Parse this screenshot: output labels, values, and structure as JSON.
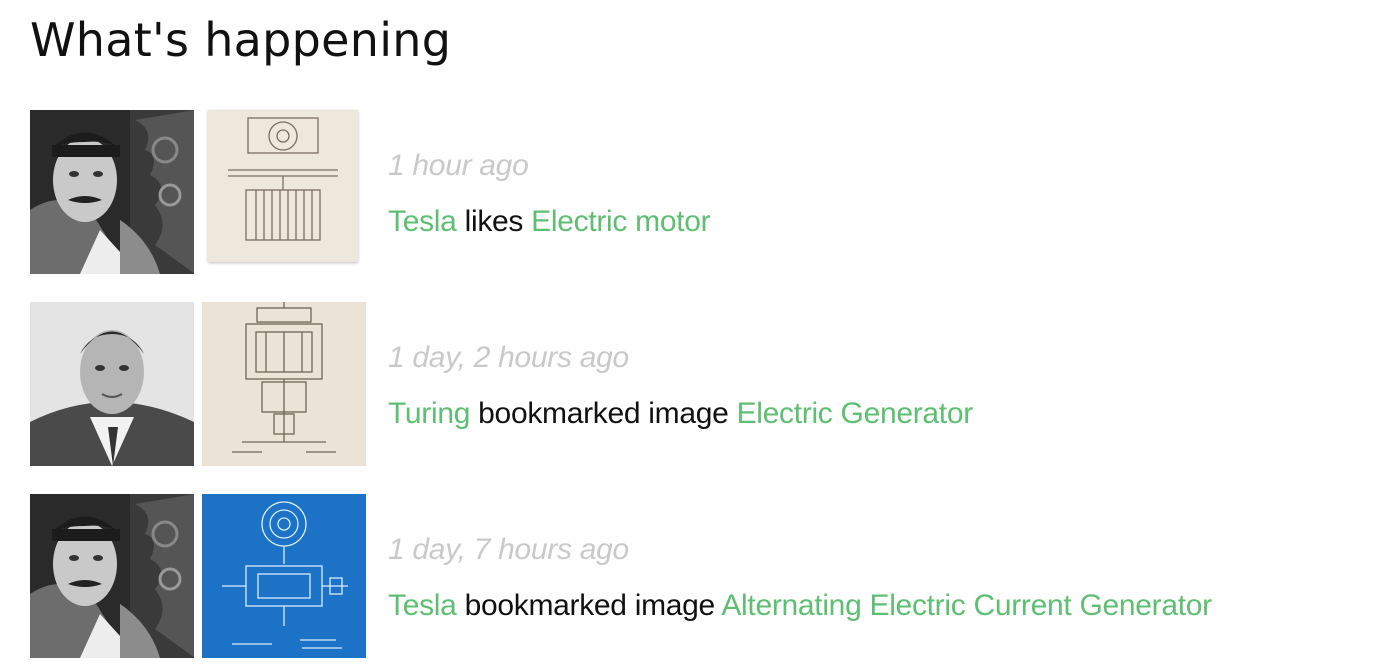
{
  "title": "What's happening",
  "feed": [
    {
      "avatar": "tesla-portrait",
      "object": "patent-drawing-sepia",
      "time": "1 hour ago",
      "actor": "Tesla",
      "verb": "likes",
      "target": "Electric motor"
    },
    {
      "avatar": "turing-portrait",
      "object": "patent-drawing-sepia",
      "time": "1 day, 2 hours ago",
      "actor": "Turing",
      "verb": "bookmarked image",
      "target": "Electric Generator"
    },
    {
      "avatar": "tesla-portrait",
      "object": "patent-drawing-blueprint",
      "time": "1 day, 7 hours ago",
      "actor": "Tesla",
      "verb": "bookmarked image",
      "target": "Alternating Electric Current Generator"
    }
  ],
  "colors": {
    "link": "#5ebf72",
    "timestamp": "#c9c9c9",
    "text": "#111111",
    "blueprint": "#1b72c6"
  }
}
